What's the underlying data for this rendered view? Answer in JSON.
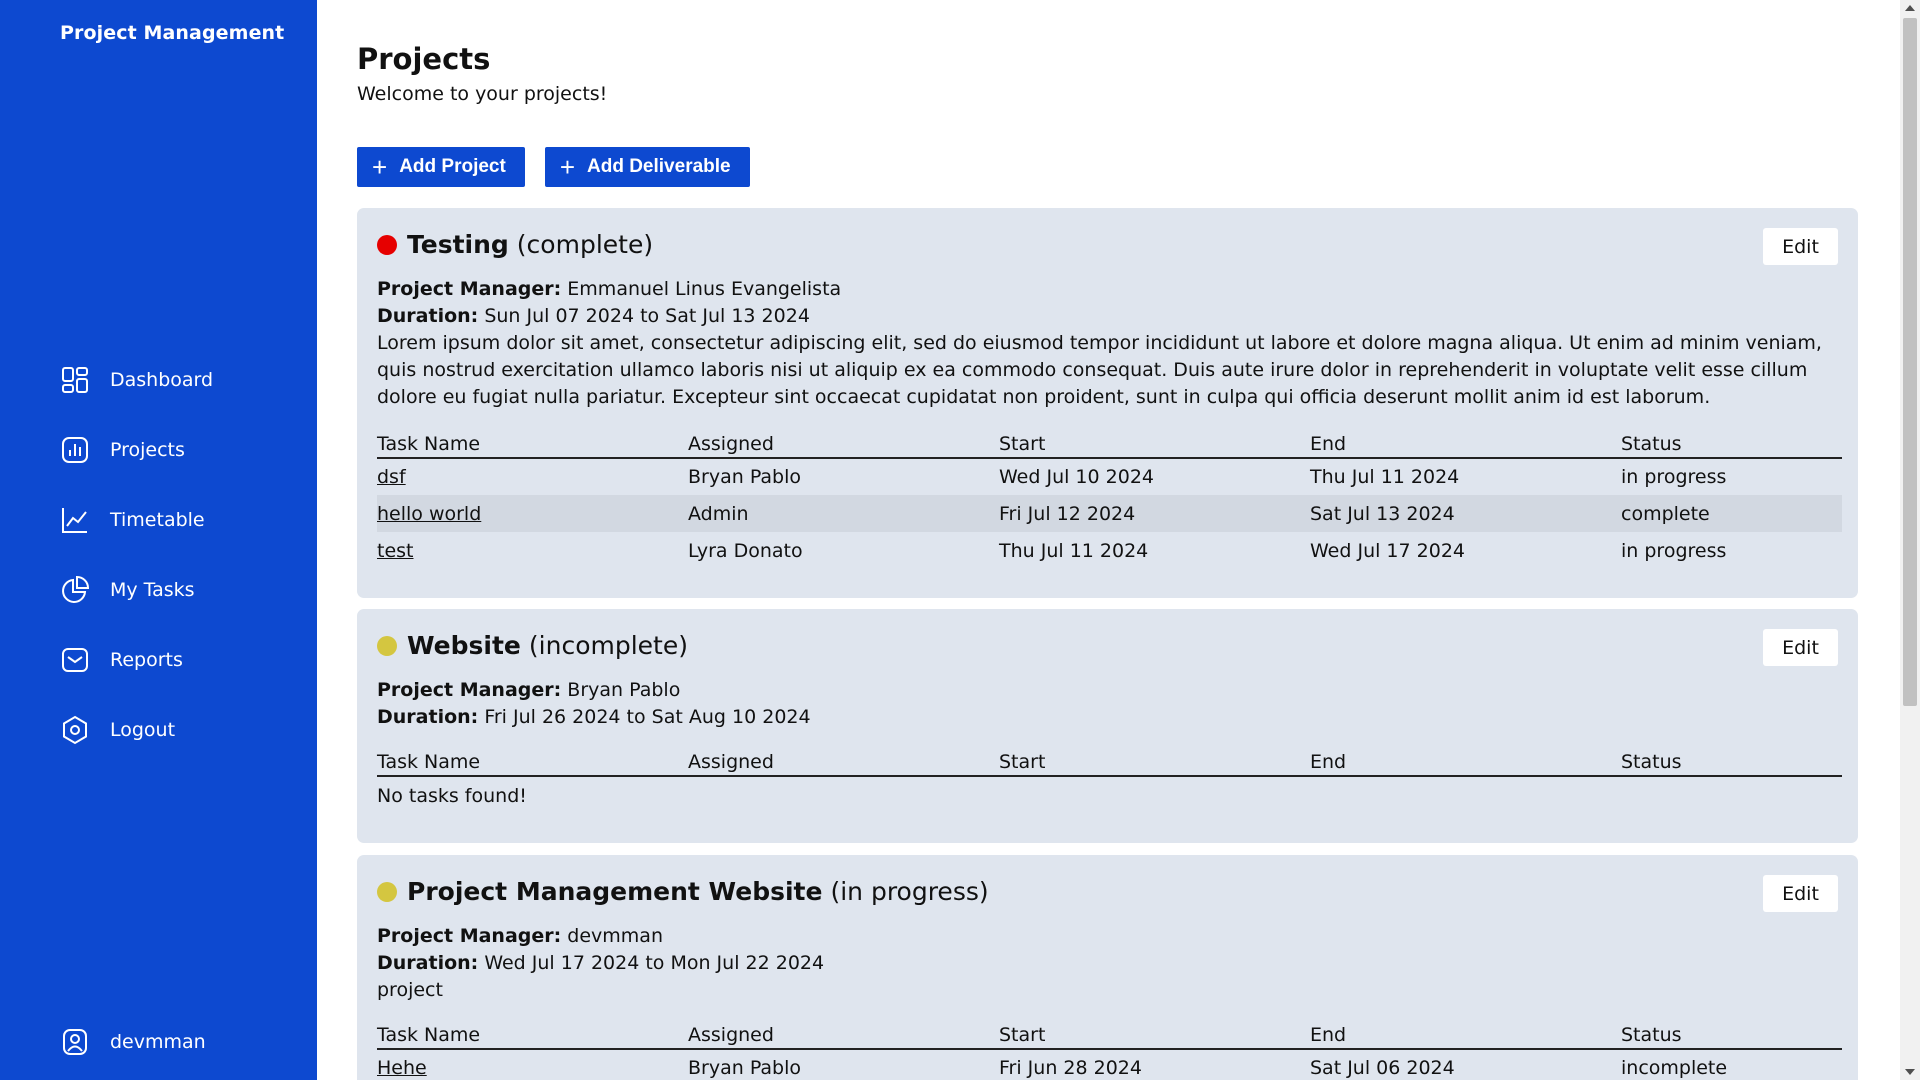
{
  "app": {
    "brand": "Project Management"
  },
  "sidebar": {
    "items": [
      {
        "label": "Dashboard",
        "icon": "dashboard-grid-icon"
      },
      {
        "label": "Projects",
        "icon": "bar-chart-icon"
      },
      {
        "label": "Timetable",
        "icon": "line-chart-icon"
      },
      {
        "label": "My Tasks",
        "icon": "pie-chart-icon"
      },
      {
        "label": "Reports",
        "icon": "mail-icon"
      },
      {
        "label": "Logout",
        "icon": "hexagon-icon"
      }
    ],
    "user": {
      "name": "devmman",
      "icon": "user-badge-icon"
    }
  },
  "header": {
    "title": "Projects",
    "subtitle": "Welcome to your projects!",
    "add_project_label": "Add Project",
    "add_deliverable_label": "Add Deliverable"
  },
  "colors": {
    "accent": "#0d49d0",
    "card_bg": "#dfe5ee",
    "status_red": "#e60000",
    "status_yellow": "#d4c640"
  },
  "table_headers": [
    "Task Name",
    "Assigned",
    "Start",
    "End",
    "Status"
  ],
  "projects": [
    {
      "name": "Testing",
      "state": "(complete)",
      "dot_color": "#e60000",
      "manager_label": "Project Manager:",
      "manager": "Emmanuel Linus Evangelista",
      "duration_label": "Duration:",
      "duration": "Sun Jul 07 2024 to Sat Jul 13 2024",
      "description": "Lorem ipsum dolor sit amet, consectetur adipiscing elit, sed do eiusmod tempor incididunt ut labore et dolore magna aliqua. Ut enim ad minim veniam, quis nostrud exercitation ullamco laboris nisi ut aliquip ex ea commodo consequat. Duis aute irure dolor in reprehenderit in voluptate velit esse cillum dolore eu fugiat nulla pariatur. Excepteur sint occaecat cupidatat non proident, sunt in culpa qui officia deserunt mollit anim id est laborum.",
      "edit_label": "Edit",
      "tasks": [
        {
          "name": "dsf",
          "assigned": "Bryan Pablo",
          "start": "Wed Jul 10 2024",
          "end": "Thu Jul 11 2024",
          "status": "in progress"
        },
        {
          "name": "hello world",
          "assigned": "Admin",
          "start": "Fri Jul 12 2024",
          "end": "Sat Jul 13 2024",
          "status": "complete"
        },
        {
          "name": "test",
          "assigned": "Lyra Donato",
          "start": "Thu Jul 11 2024",
          "end": "Wed Jul 17 2024",
          "status": "in progress"
        }
      ]
    },
    {
      "name": "Website",
      "state": "(incomplete)",
      "dot_color": "#d4c640",
      "manager_label": "Project Manager:",
      "manager": "Bryan Pablo",
      "duration_label": "Duration:",
      "duration": "Fri Jul 26 2024 to Sat Aug 10 2024",
      "description": "",
      "edit_label": "Edit",
      "empty_text": "No tasks found!",
      "tasks": []
    },
    {
      "name": "Project Management Website",
      "state": "(in progress)",
      "dot_color": "#d4c640",
      "manager_label": "Project Manager:",
      "manager": "devmman",
      "duration_label": "Duration:",
      "duration": "Wed Jul 17 2024 to Mon Jul 22 2024",
      "description": "project",
      "edit_label": "Edit",
      "tasks": [
        {
          "name": "Hehe",
          "assigned": "Bryan Pablo",
          "start": "Fri Jun 28 2024",
          "end": "Sat Jul 06 2024",
          "status": "incomplete"
        }
      ]
    }
  ]
}
